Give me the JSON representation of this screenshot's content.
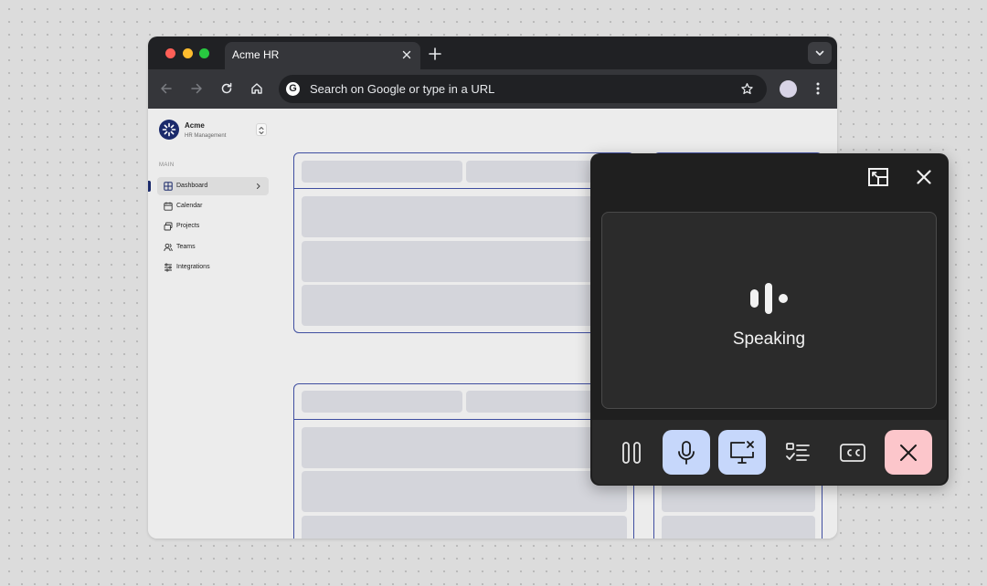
{
  "browser": {
    "tab_title": "Acme HR",
    "url_placeholder": "Search on Google or type in a URL",
    "google_logo_letter": "G",
    "icons": [
      "close-icon",
      "plus-icon",
      "chevron-down-icon",
      "back-arrow-icon",
      "forward-arrow-icon",
      "reload-icon",
      "home-icon",
      "star-icon",
      "kebab-menu-icon"
    ]
  },
  "app": {
    "brand": {
      "name": "Acme",
      "subtitle": "HR Management"
    },
    "sidebar": {
      "section_label": "MAIN",
      "items": [
        {
          "label": "Dashboard",
          "icon": "grid-icon",
          "active": true
        },
        {
          "label": "Calendar",
          "icon": "calendar-icon",
          "active": false
        },
        {
          "label": "Projects",
          "icon": "projects-icon",
          "active": false
        },
        {
          "label": "Teams",
          "icon": "users-icon",
          "active": false
        },
        {
          "label": "Integrations",
          "icon": "sliders-icon",
          "active": false
        }
      ]
    }
  },
  "voice_panel": {
    "status": "Speaking",
    "icons": [
      "picture-in-picture-icon",
      "close-icon",
      "speaking-wave-icon"
    ],
    "controls": [
      {
        "name": "pause",
        "icon": "pause-icon"
      },
      {
        "name": "mic",
        "icon": "microphone-icon",
        "state": "active"
      },
      {
        "name": "screen-share",
        "icon": "screen-share-off-icon",
        "state": "active"
      },
      {
        "name": "tasks",
        "icon": "checklist-icon"
      },
      {
        "name": "captions",
        "icon": "closed-captions-icon"
      },
      {
        "name": "end",
        "icon": "end-call-icon",
        "state": "danger"
      }
    ]
  },
  "colors": {
    "page_bg": "#dcdcdc",
    "tab_strip": "#202124",
    "toolbar": "#35363a",
    "accent_navy": "#1b2a6b",
    "card_border": "#3f4ea0",
    "placeholder": "#d4d5db",
    "panel_bg": "#1f1f1f",
    "control_active_blue": "#c6d7fb",
    "control_danger_pink": "#fcc6cb"
  }
}
